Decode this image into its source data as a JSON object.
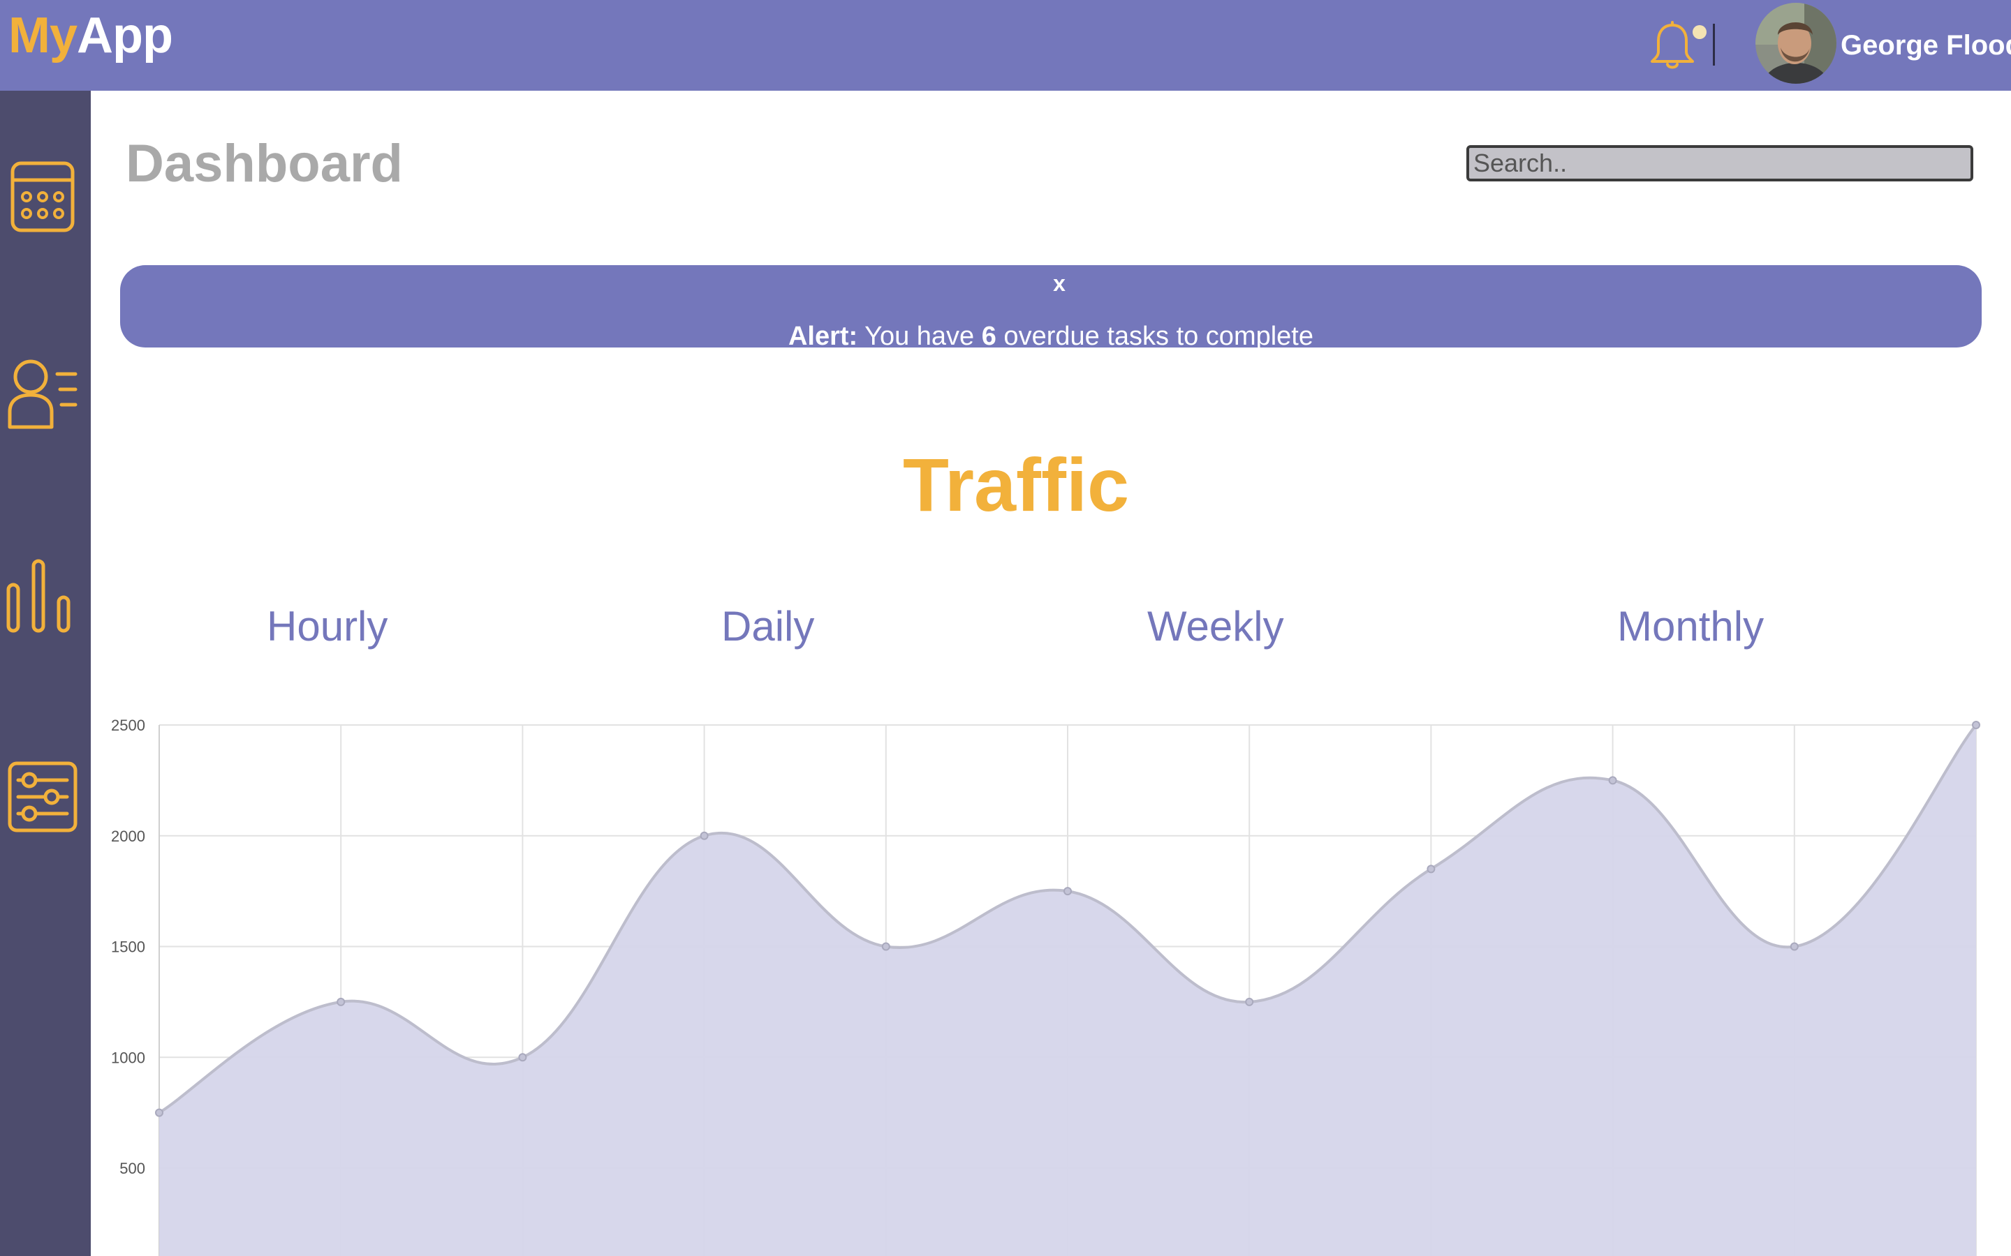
{
  "header": {
    "logo_prefix": "My",
    "logo_suffix": "App",
    "user_name": "George Flood",
    "notification_icon": "bell-icon",
    "has_unread": true
  },
  "sidebar": {
    "items": [
      {
        "icon": "calendar-icon"
      },
      {
        "icon": "members-list-icon"
      },
      {
        "icon": "bar-chart-icon"
      },
      {
        "icon": "settings-sliders-icon"
      }
    ]
  },
  "main": {
    "title": "Dashboard",
    "search_placeholder": "Search..",
    "alert": {
      "close_label": "x",
      "label": "Alert:",
      "text_before": " You have ",
      "count": "6",
      "text_after": " overdue tasks to complete"
    },
    "traffic": {
      "title": "Traffic",
      "tabs": [
        "Hourly",
        "Daily",
        "Weekly",
        "Monthly"
      ]
    }
  },
  "colors": {
    "primary": "#7477bb",
    "accent": "#f2b13b",
    "sidebar": "#4d4c6d",
    "chart_fill": "#d5d5ea"
  },
  "chart_data": {
    "type": "area",
    "x": [
      0,
      1,
      2,
      3,
      4,
      5,
      6,
      7,
      8,
      9,
      10
    ],
    "values": [
      750,
      1250,
      1000,
      2000,
      1500,
      1750,
      1250,
      1850,
      2250,
      1500,
      2500
    ],
    "y_ticks": [
      500,
      1000,
      1500,
      2000,
      2500
    ],
    "ylim": [
      0,
      2500
    ],
    "grid": true,
    "smooth": true
  }
}
